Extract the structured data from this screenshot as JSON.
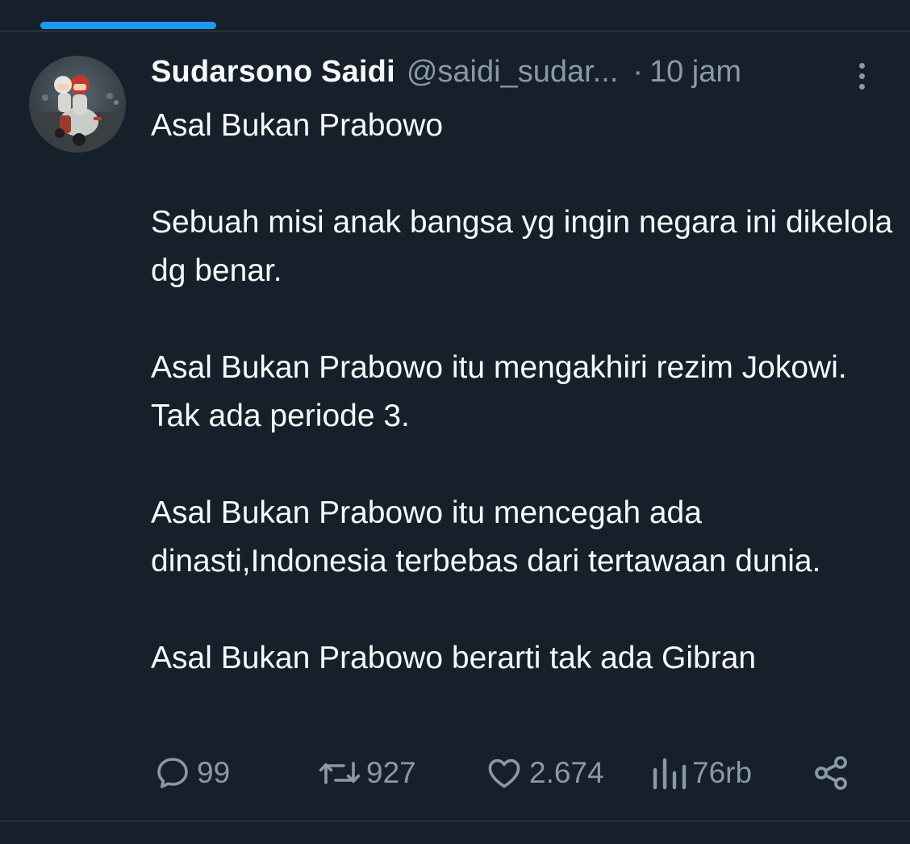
{
  "tweet": {
    "display_name": "Sudarsono Saidi",
    "handle": "@saidi_sudar...",
    "separator": "·",
    "time": "10 jam",
    "paragraphs": [
      "Asal Bukan Prabowo",
      "Sebuah misi anak bangsa yg ingin negara ini dikelola dg benar.",
      "Asal Bukan Prabowo itu mengakhiri rezim Jokowi. Tak ada periode 3.",
      "Asal Bukan Prabowo itu mencegah ada dinasti,Indonesia terbebas dari tertawaan dunia.",
      "Asal Bukan Prabowo berarti tak ada Gibran"
    ]
  },
  "actions": {
    "replies": "99",
    "reposts": "927",
    "likes": "2.674",
    "views": "76rb"
  },
  "icons": {
    "reply": "reply-icon",
    "repost": "repost-icon",
    "like": "heart-icon",
    "views": "views-icon",
    "share": "share-icon",
    "more": "more-vertical-icon"
  },
  "colors": {
    "background": "#15202b",
    "text": "#f7f9f9",
    "secondary_text": "#8b98a5",
    "accent": "#1d9bf0",
    "divider": "#38444d"
  }
}
